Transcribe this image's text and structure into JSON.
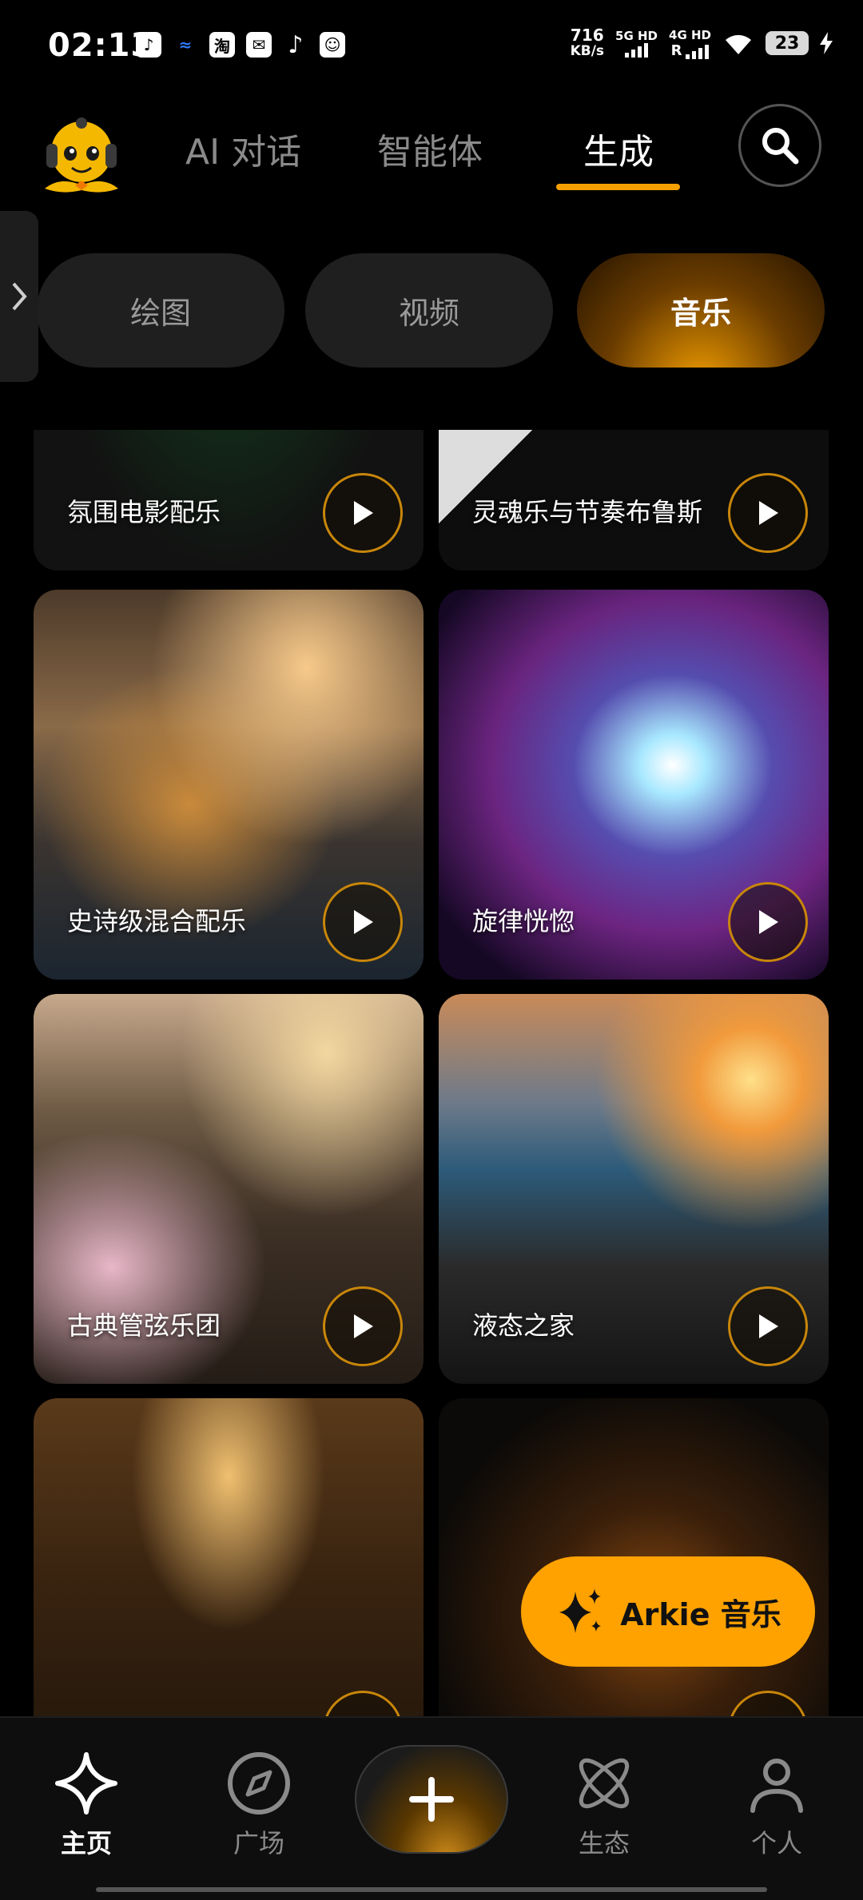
{
  "status_bar": {
    "time": "02:13",
    "net_speed_value": "716",
    "net_speed_unit": "KB/s",
    "sim1": "5G HD",
    "sim2": "4G HD",
    "roaming": "R",
    "battery": "23",
    "app_icons": [
      "douyin-icon",
      "blue-app-icon",
      "taobao-icon",
      "message-icon",
      "tiktok-icon",
      "avatar-app-icon"
    ]
  },
  "top_nav": {
    "tabs": [
      {
        "label": "AI 对话",
        "active": false
      },
      {
        "label": "智能体",
        "active": false
      },
      {
        "label": "生成",
        "active": true
      }
    ]
  },
  "sub_tabs": [
    {
      "label": "绘图",
      "active": false
    },
    {
      "label": "视频",
      "active": false
    },
    {
      "label": "音乐",
      "active": true
    }
  ],
  "cards": [
    {
      "title": "氛围电影配乐"
    },
    {
      "title": "灵魂乐与节奏布鲁斯"
    },
    {
      "title": "史诗级混合配乐"
    },
    {
      "title": "旋律恍惚"
    },
    {
      "title": "古典管弦乐团"
    },
    {
      "title": "液态之家"
    },
    {
      "title": ""
    },
    {
      "title": ""
    }
  ],
  "fab": {
    "label": "Arkie 音乐"
  },
  "bottom_nav": [
    {
      "label": "主页",
      "active": true
    },
    {
      "label": "广场",
      "active": false
    },
    {
      "label": "",
      "icon": "plus-icon"
    },
    {
      "label": "生态",
      "active": false
    },
    {
      "label": "个人",
      "active": false
    }
  ],
  "colors": {
    "accent": "#F5A000",
    "fab": "#FFA200",
    "background": "#000000"
  }
}
